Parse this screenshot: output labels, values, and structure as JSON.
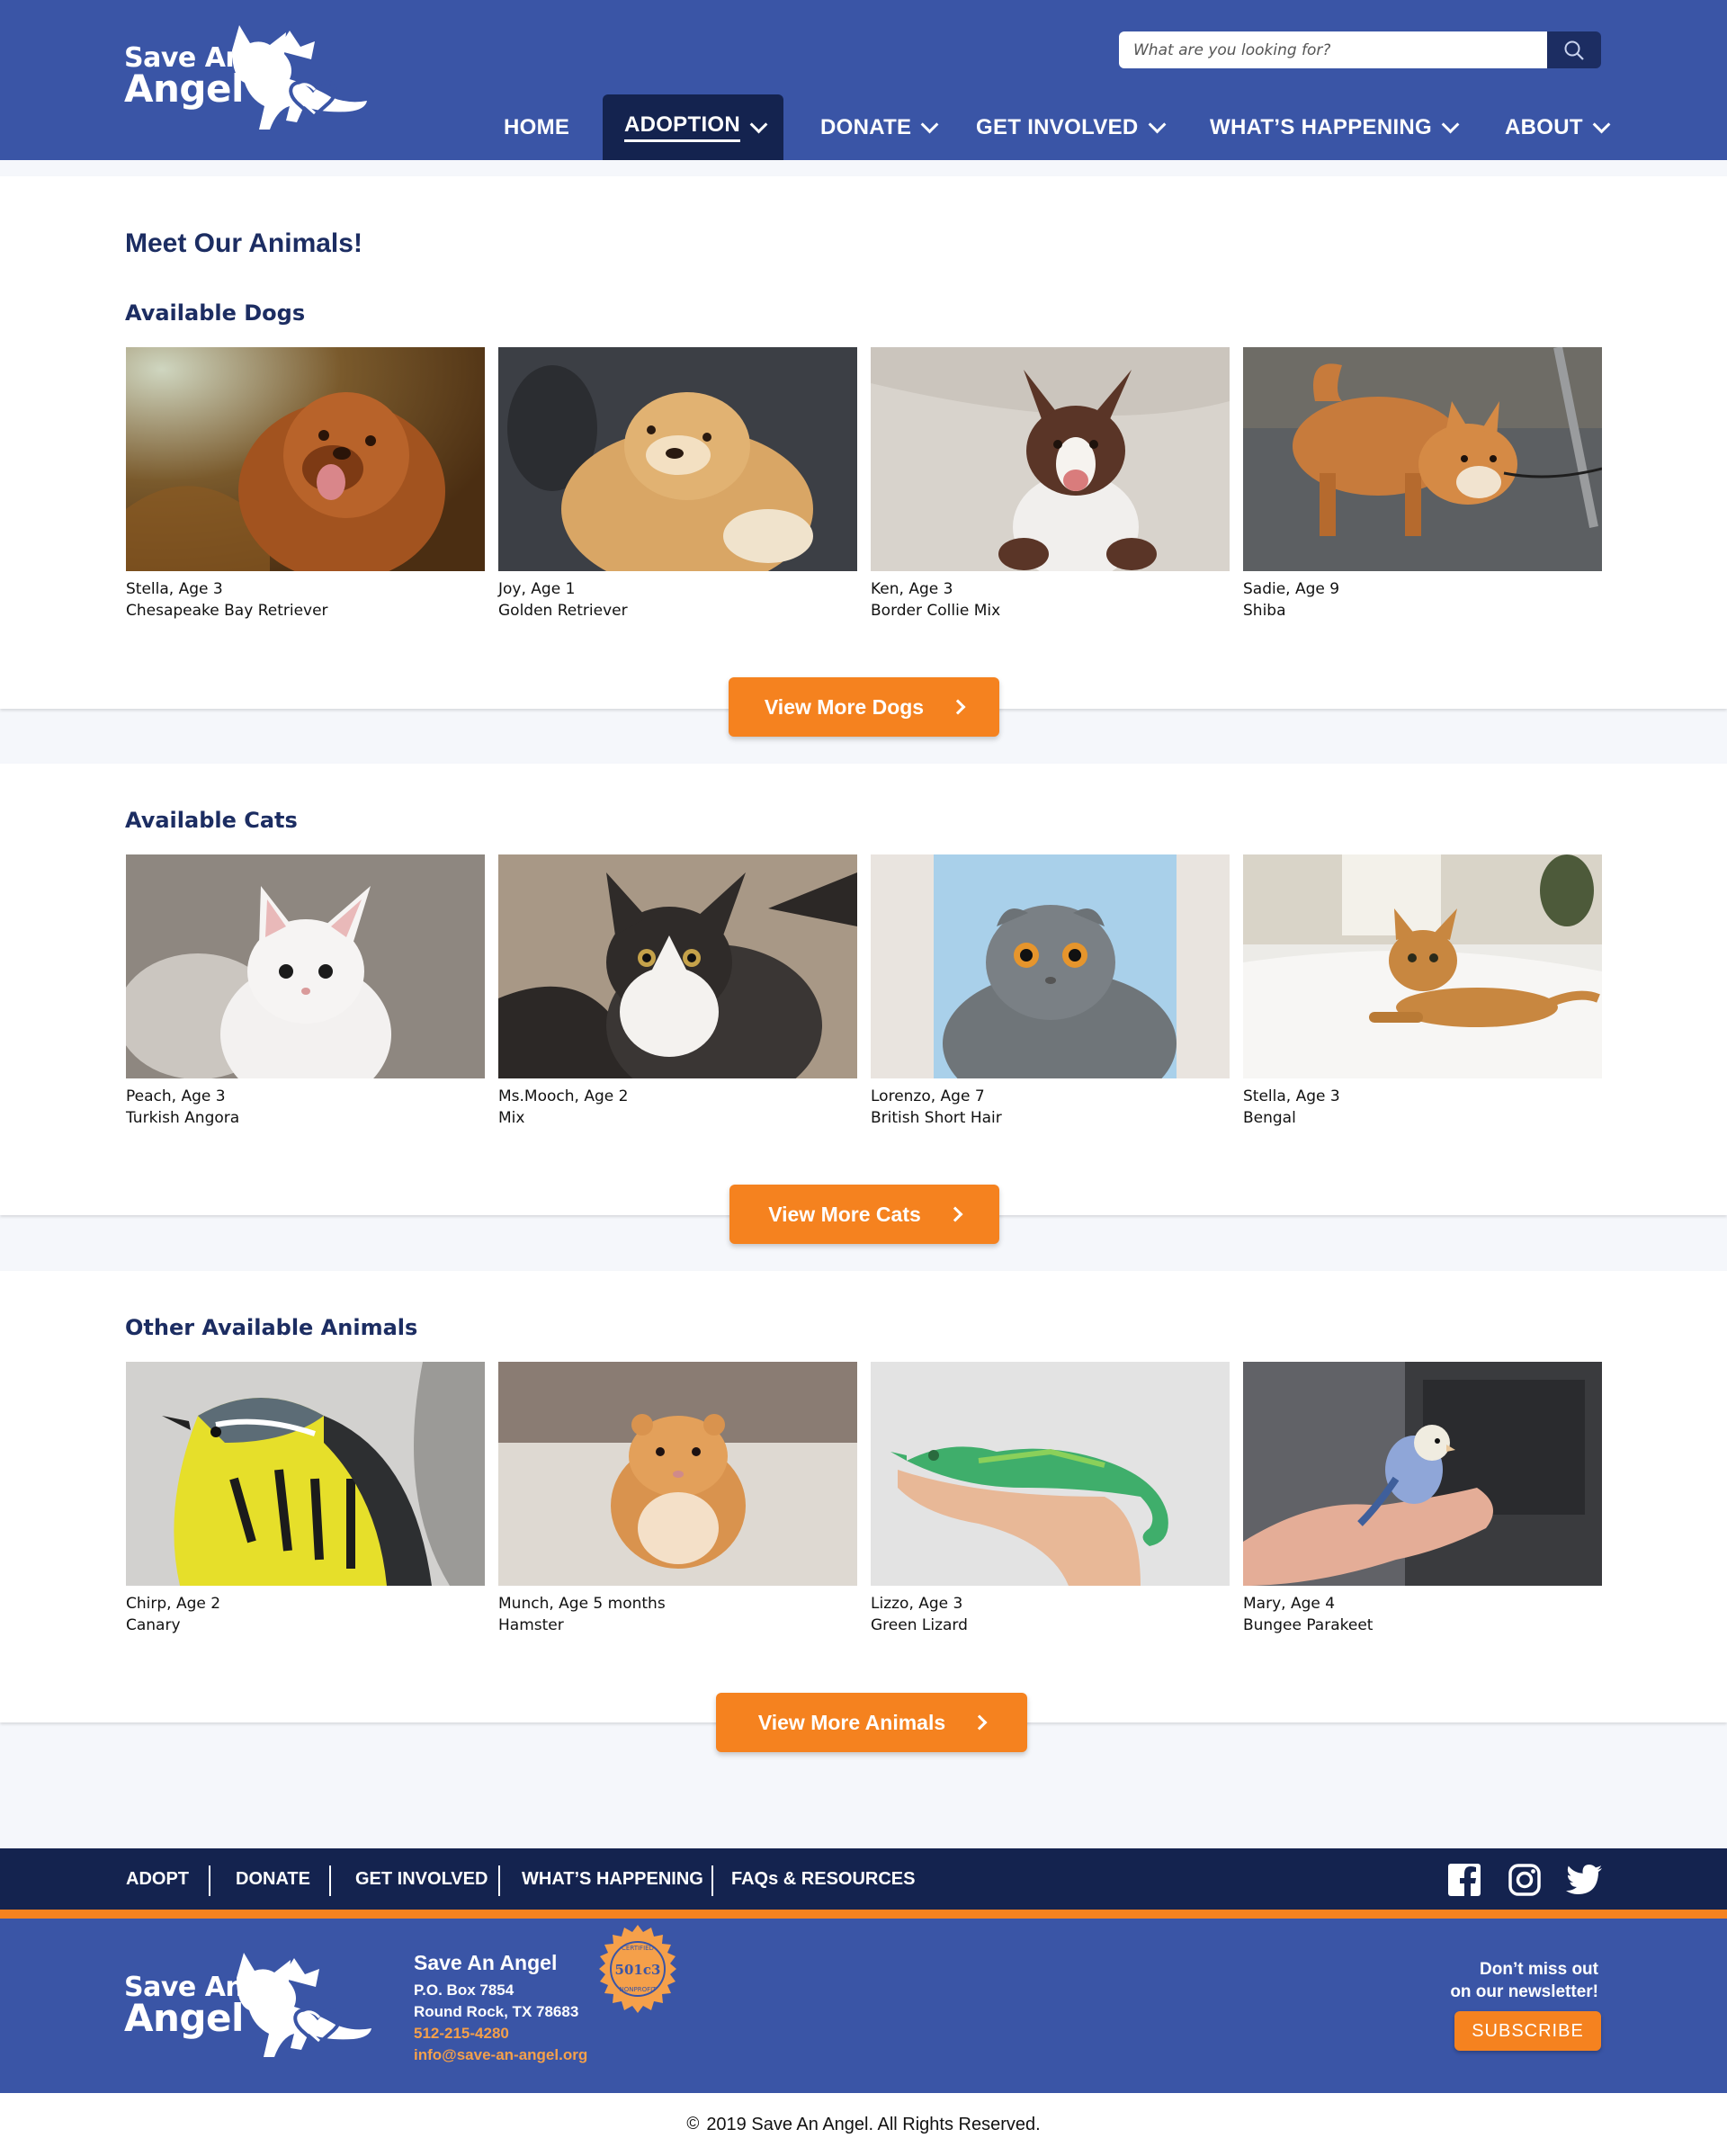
{
  "brand": {
    "line1": "Save An",
    "line2": "Angel"
  },
  "search": {
    "placeholder": "What are you looking for?"
  },
  "nav": {
    "items": [
      {
        "label": "HOME"
      },
      {
        "label": "ADOPTION"
      },
      {
        "label": "DONATE"
      },
      {
        "label": "GET INVOLVED"
      },
      {
        "label": "WHAT’S HAPPENING"
      },
      {
        "label": "ABOUT"
      }
    ]
  },
  "page": {
    "title": "Meet Our Animals!"
  },
  "dogs": {
    "title": "Available Dogs",
    "button": "View More Dogs",
    "cards": [
      {
        "name": "Stella, Age 3",
        "breed": "Chesapeake Bay Retriever"
      },
      {
        "name": "Joy, Age 1",
        "breed": "Golden Retriever"
      },
      {
        "name": "Ken, Age 3",
        "breed": "Border Collie Mix"
      },
      {
        "name": "Sadie, Age 9",
        "breed": "Shiba"
      }
    ]
  },
  "cats": {
    "title": "Available Cats",
    "button": "View More Cats",
    "cards": [
      {
        "name": "Peach, Age 3",
        "breed": "Turkish Angora"
      },
      {
        "name": "Ms.Mooch, Age 2",
        "breed": "Mix"
      },
      {
        "name": "Lorenzo, Age 7",
        "breed": "British Short Hair"
      },
      {
        "name": "Stella, Age 3",
        "breed": "Bengal"
      }
    ]
  },
  "others": {
    "title": "Other Available Animals",
    "button": "View More Animals",
    "cards": [
      {
        "name": "Chirp, Age 2",
        "breed": "Canary"
      },
      {
        "name": "Munch, Age 5 months",
        "breed": "Hamster"
      },
      {
        "name": "Lizzo, Age 3",
        "breed": "Green Lizard"
      },
      {
        "name": "Mary, Age 4",
        "breed": "Bungee Parakeet"
      }
    ]
  },
  "footer": {
    "nav": [
      "ADOPT",
      "DONATE",
      "GET INVOLVED",
      "WHAT’S HAPPENING",
      "FAQs & RESOURCES"
    ],
    "social": [
      "facebook-icon",
      "instagram-icon",
      "twitter-icon"
    ],
    "org": {
      "name": "Save An Angel",
      "address1": "P.O. Box 7854",
      "address2": "Round Rock, TX 78683",
      "phone": "512-215-4280",
      "email": "info@save-an-angel.org"
    },
    "seal": {
      "top": "CERTIFIED",
      "middle": "501c3",
      "bottom": "NONPROFIT"
    },
    "newsletter": {
      "line1": "Don’t miss out",
      "line2": "on our newsletter!",
      "button": "SUBSCRIBE"
    },
    "copyright": "2019 Save An Angel. All Rights Reserved."
  },
  "colors": {
    "brand_blue": "#3a55a6",
    "navy": "#14234f",
    "accent_orange": "#f5821f"
  }
}
